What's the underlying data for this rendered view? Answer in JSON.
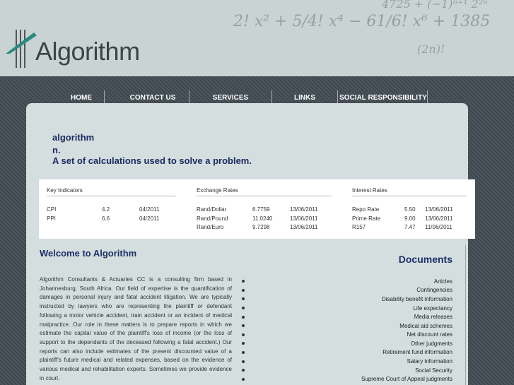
{
  "header": {
    "logo_text": "Algorithm",
    "math_lines": [
      "2! x² + 5/4! x⁴ − 61/6! x⁶ + 1385",
      "4725 + (−1)ⁿ⁺¹ 2²ⁿ",
      "(2n)!"
    ]
  },
  "nav": [
    {
      "label": "HOME"
    },
    {
      "label": "CONTACT US"
    },
    {
      "label": "SERVICES"
    },
    {
      "label": "LINKS"
    },
    {
      "label": "SOCIAL RESPONSIBILITY"
    }
  ],
  "definition": {
    "word": "algorithm",
    "pos": "n.",
    "meaning": "A set of calculations used to solve a problem."
  },
  "indicators": {
    "key": {
      "title": "Key Indicators",
      "rows": [
        [
          "CPI",
          "4.2",
          "04/2011"
        ],
        [
          "PPI",
          "6.6",
          "04/2011"
        ]
      ]
    },
    "exchange": {
      "title": "Exchange Rates",
      "rows": [
        [
          "Rand/Dollar",
          "6.7759",
          "13/06/2011"
        ],
        [
          "Rand/Pound",
          "11.0240",
          "13/06/2011"
        ],
        [
          "Rand/Euro",
          "9.7298",
          "13/06/2011"
        ]
      ]
    },
    "interest": {
      "title": "Interest Rates",
      "rows": [
        [
          "Repo Rate",
          "5.50",
          "13/06/2011"
        ],
        [
          "Prime Rate",
          "9.00",
          "13/06/2011"
        ],
        [
          "R157",
          "7.47",
          "11/06/2011"
        ]
      ]
    }
  },
  "welcome": {
    "title": "Welcome to Algorithm",
    "body": "Algorithm Consultants & Actuaries CC is a consulting firm based in Johannesburg, South Africa. Our field of expertise is the quantification of damages in personal injury and fatal accident litigation. We are typically instructed by lawyers who are representing the plaintiff or defendant following a motor vehicle accident, train accident or an incident of medical malpractice. Our role in these matters is to prepare reports in which we estimate the capital value of the plaintiff's loss of income (or the loss of support to the dependants of the deceased following a fatal accident.) Our reports can also include estimates of the present discounted value of a plaintiff's future medical and related expenses, based on the evidence of various medical and rehabilitation experts. Sometimes we provide evidence in court."
  },
  "documents": {
    "title": "Documents",
    "items": [
      "Articles",
      "Contingencies",
      "Disability benefit information",
      "Life expectancy",
      "Media releases",
      "Medical aid schemes",
      "Net discount rates",
      "Other judgments",
      "Retirement fund information",
      "Salary information",
      "Social Security",
      "Supreme Court of Appeal judgments"
    ]
  },
  "colors": {
    "accent": "#1f2e6b",
    "logo_teal": "#2a8a7e",
    "nav_bg": "#4a525a"
  }
}
